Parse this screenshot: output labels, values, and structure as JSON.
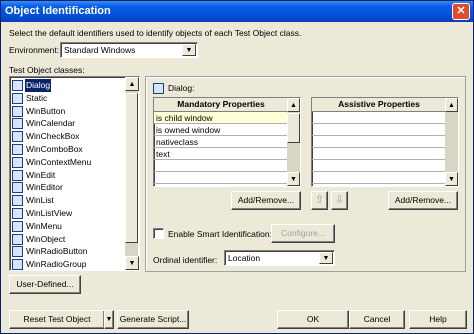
{
  "window": {
    "title": "Object Identification",
    "close_glyph": "✕"
  },
  "description": "Select the default identifiers used to identify objects of each Test Object class.",
  "environment": {
    "label": "Environment:",
    "value": "Standard Windows"
  },
  "classes": {
    "label": "Test Object classes:",
    "items": [
      "Dialog",
      "Static",
      "WinButton",
      "WinCalendar",
      "WinCheckBox",
      "WinComboBox",
      "WinContextMenu",
      "WinEdit",
      "WinEditor",
      "WinList",
      "WinListView",
      "WinMenu",
      "WinObject",
      "WinRadioButton",
      "WinRadioGroup"
    ],
    "selected_index": 0
  },
  "details": {
    "class_label": "Dialog:",
    "mandatory": {
      "header": "Mandatory Properties",
      "rows": [
        "is child window",
        "is owned window",
        "nativeclass",
        "text"
      ]
    },
    "assistive": {
      "header": "Assistive Properties",
      "rows": []
    },
    "add_remove_label": "Add/Remove...",
    "up_glyph": "⇧",
    "down_glyph": "⇩",
    "smart_id": {
      "label": "Enable Smart Identification:",
      "checked": false,
      "configure_label": "Configure..."
    },
    "ordinal": {
      "label": "Ordinal identifier:",
      "value": "Location"
    }
  },
  "buttons": {
    "user_defined": "User-Defined...",
    "reset_test_object": "Reset Test Object",
    "generate_script": "Generate Script...",
    "ok": "OK",
    "cancel": "Cancel",
    "help": "Help"
  },
  "glyphs": {
    "scroll_up": "▲",
    "scroll_down": "▼",
    "combo_arrow": "▼",
    "split_arrow": "▼"
  }
}
